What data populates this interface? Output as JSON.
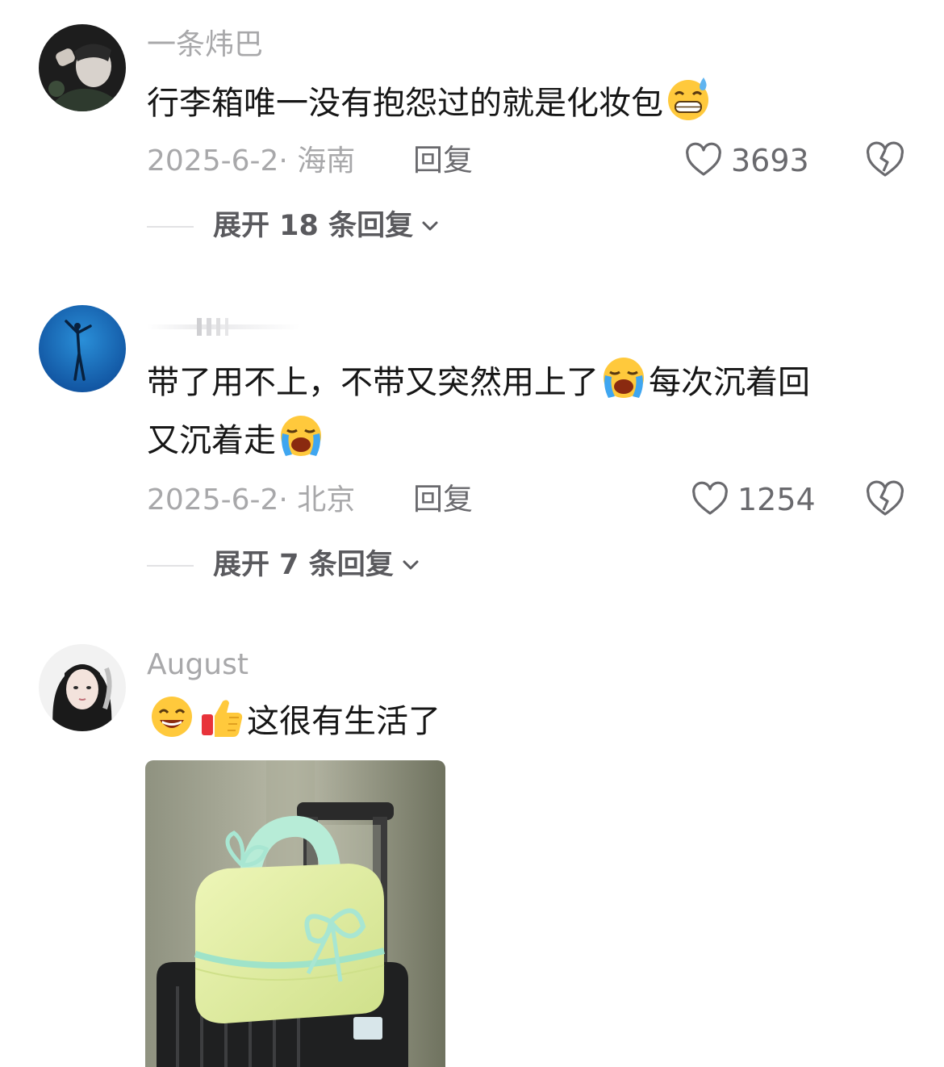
{
  "comments": [
    {
      "username": "一条炜巴",
      "text": "行李箱唯一没有抱怨过的就是化妆包",
      "emoji_end": "grin-sweat-emoji",
      "date": "2025-6-2",
      "location": "海南",
      "reply_label": "回复",
      "likes": "3693",
      "expand_label": "展开 18 条回复"
    },
    {
      "username": "",
      "text_line1": "带了用不上，不带又突然用上了",
      "text_line1_after": "每次沉着回",
      "text_line2": "又沉着走",
      "emoji_inline": "loudly-crying-emoji",
      "date": "2025-6-2",
      "location": "北京",
      "reply_label": "回复",
      "likes": "1254",
      "expand_label": "展开 7 条回复"
    },
    {
      "username": "August",
      "text": "这很有生活了",
      "emoji_start": [
        "smile-emoji",
        "thumbs-up-emoji"
      ],
      "photo": "makeup-bag-photo"
    }
  ],
  "icons": {
    "like": "heart-outline-icon",
    "dislike": "broken-heart-icon",
    "expand": "chevron-down-icon"
  },
  "colors": {
    "text_primary": "#161616",
    "text_secondary": "#a8a8aa",
    "action_gray": "#6a6a6e"
  }
}
